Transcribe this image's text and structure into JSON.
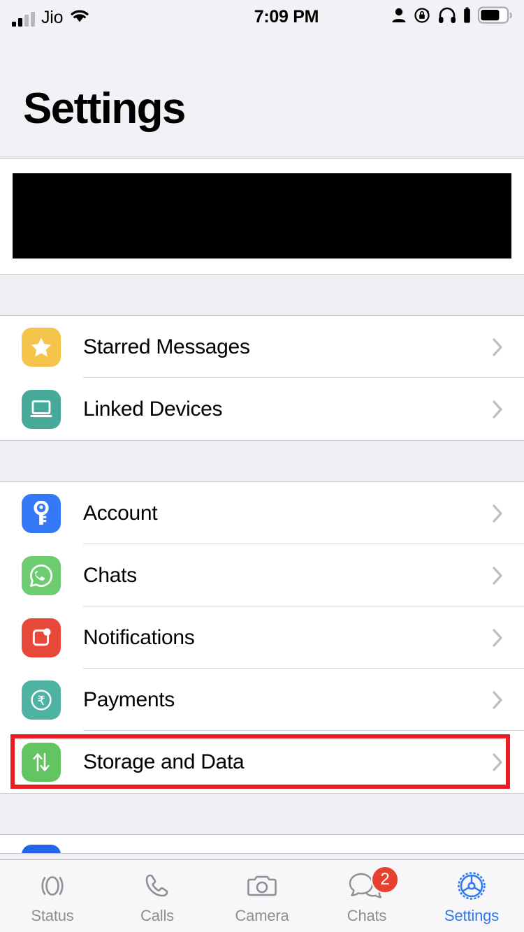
{
  "status_bar": {
    "carrier": "Jio",
    "time": "7:09 PM",
    "icons": [
      "signal-bars-icon",
      "wifi-icon",
      "person-icon",
      "rotation-lock-icon",
      "headphones-icon",
      "headphone-battery-icon",
      "battery-icon"
    ]
  },
  "header": {
    "title": "Settings"
  },
  "profile": {
    "redacted": true,
    "label": ""
  },
  "groups": [
    {
      "name": "starred-linked-group",
      "rows": [
        {
          "label": "Starred Messages",
          "icon": "star-icon",
          "color": "#F5C54B",
          "highlighted": false
        },
        {
          "label": "Linked Devices",
          "icon": "laptop-icon",
          "color": "#46A99A",
          "highlighted": false
        }
      ]
    },
    {
      "name": "account-settings-group",
      "rows": [
        {
          "label": "Account",
          "icon": "key-icon",
          "color": "#3478F6",
          "highlighted": false
        },
        {
          "label": "Chats",
          "icon": "whatsapp-icon",
          "color": "#6DCB70",
          "highlighted": false
        },
        {
          "label": "Notifications",
          "icon": "notification-bell-icon",
          "color": "#E8483A",
          "highlighted": false
        },
        {
          "label": "Payments",
          "icon": "rupee-icon",
          "color": "#4FB3A4",
          "highlighted": false
        },
        {
          "label": "Storage and Data",
          "icon": "storage-arrows-icon",
          "color": "#63C462",
          "highlighted": true
        }
      ]
    }
  ],
  "highlight": {
    "color": "#EC1C24"
  },
  "tab_bar": {
    "tabs": [
      {
        "label": "Status",
        "icon": "status-rings-icon",
        "active": false,
        "badge": ""
      },
      {
        "label": "Calls",
        "icon": "phone-icon",
        "active": false,
        "badge": ""
      },
      {
        "label": "Camera",
        "icon": "camera-icon",
        "active": false,
        "badge": ""
      },
      {
        "label": "Chats",
        "icon": "chat-bubbles-icon",
        "active": false,
        "badge": "2"
      },
      {
        "label": "Settings",
        "icon": "gear-icon",
        "active": true,
        "badge": ""
      }
    ],
    "active_color": "#2E78F0",
    "inactive_color": "#8E8E93",
    "badge_color": "#E8402F"
  }
}
